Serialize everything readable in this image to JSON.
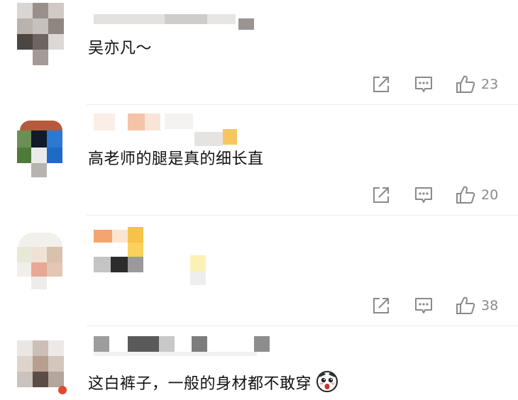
{
  "comments": [
    {
      "text": "吴亦凡～",
      "actions": {
        "share_icon": "share-icon",
        "reply_icon": "comment-icon",
        "like_icon": "thumbs-up-icon",
        "likes": "23"
      }
    },
    {
      "text": "高老师的腿是真的细长直",
      "actions": {
        "share_icon": "share-icon",
        "reply_icon": "comment-icon",
        "like_icon": "thumbs-up-icon",
        "likes": "20"
      }
    },
    {
      "text": "",
      "actions": {
        "share_icon": "share-icon",
        "reply_icon": "comment-icon",
        "like_icon": "thumbs-up-icon",
        "likes": "38"
      }
    },
    {
      "text": "这白裤子，一般的身材都不敢穿",
      "emoji": "surprised-face-emoji",
      "actions": {}
    }
  ],
  "colors": {
    "text": "#111111",
    "icon": "#8a8a8a",
    "divider": "#ececec"
  }
}
